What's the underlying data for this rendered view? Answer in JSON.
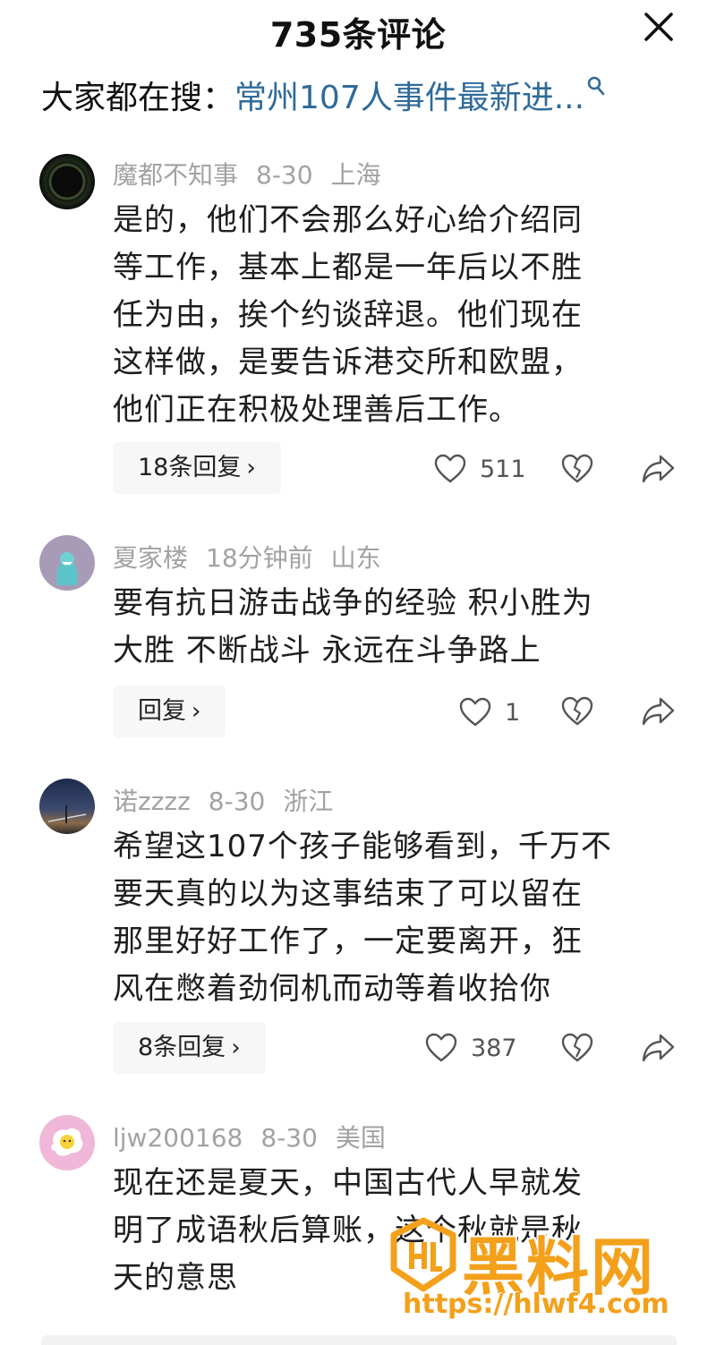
{
  "header": {
    "title": "735条评论"
  },
  "search": {
    "prefix": "大家都在搜：",
    "query": "常州107人事件最新进..."
  },
  "comments": [
    {
      "username": "魔都不知事",
      "date": "8-30",
      "location": "上海",
      "lines": [
        "是的，他们不会那么好心给介绍同",
        "等工作，基本上都是一年后以不胜",
        "任为由，挨个约谈辞退。他们现在",
        "这样做，是要告诉港交所和欧盟，",
        "他们正在积极处理善后工作。"
      ],
      "reply_label": "18条回复",
      "likes": "511"
    },
    {
      "username": "夏家楼",
      "date": "18分钟前",
      "location": "山东",
      "lines": [
        "要有抗日游击战争的经验 积小胜为",
        "大胜 不断战斗 永远在斗争路上"
      ],
      "reply_label": "回复",
      "likes": "1"
    },
    {
      "username": "诺zzzz",
      "date": "8-30",
      "location": "浙江",
      "lines": [
        "希望这107个孩子能够看到，千万不",
        "要天真的以为这事结束了可以留在",
        "那里好好工作了，一定要离开，狂",
        "风在憋着劲伺机而动等着收拾你"
      ],
      "reply_label": "8条回复",
      "likes": "387"
    },
    {
      "username": "ljw200168",
      "date": "8-30",
      "location": "美国",
      "lines": [
        "现在还是夏天，中国古代人早就发",
        "明了成语秋后算账，这个秋就是秋",
        "天的意思"
      ]
    }
  ],
  "watermark": {
    "brand": "黑料网",
    "url": "https://hlwf4.com"
  },
  "colors": {
    "link_blue": "#2f6b9a",
    "meta_gray": "#a2a2a2",
    "watermark_orange": "#f3a01b",
    "pill_bg": "#f7f7f7"
  },
  "icons": {
    "close": "close-icon",
    "search": "search-icon",
    "like": "heart-icon",
    "dislike": "broken-heart-icon",
    "share": "share-arrow-icon",
    "chevron": "chevron-right-icon"
  }
}
